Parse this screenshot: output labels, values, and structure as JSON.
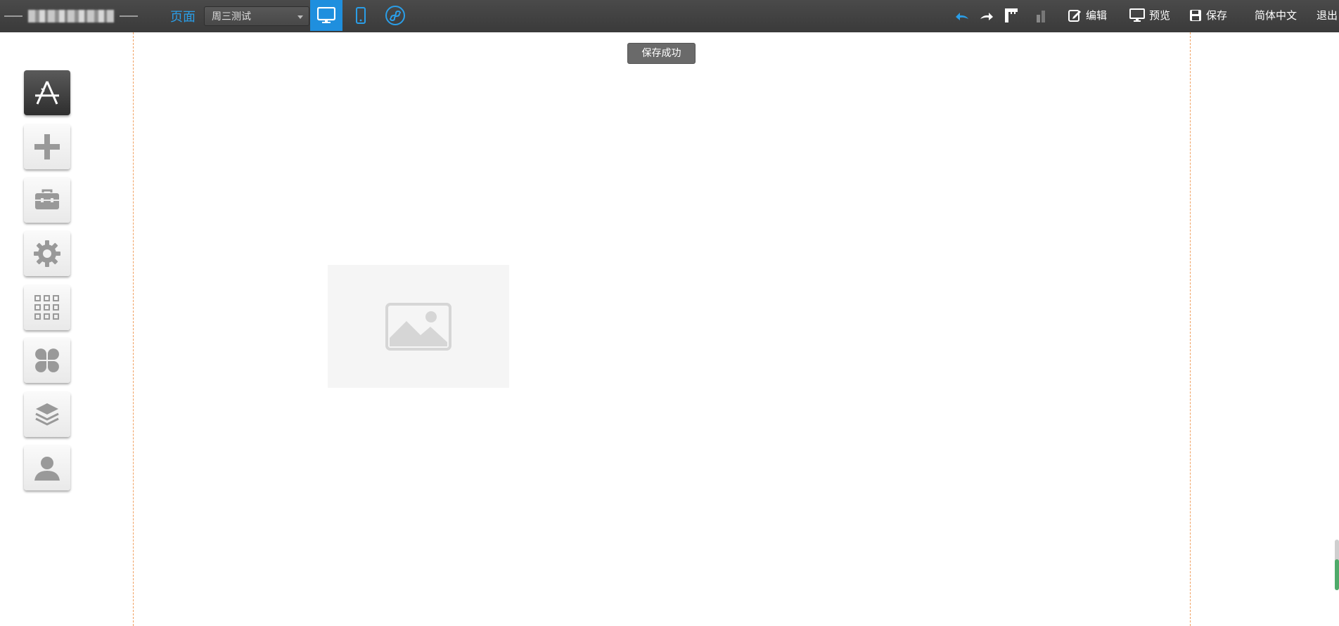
{
  "topbar": {
    "page_label": "页面",
    "page_select_value": "周三测试",
    "devices": [
      {
        "name": "desktop",
        "icon": "monitor-icon",
        "active": true
      },
      {
        "name": "mobile",
        "icon": "phone-icon",
        "active": false
      },
      {
        "name": "mini-program",
        "icon": "miniprogram-icon",
        "active": false
      }
    ],
    "edit_label": "编辑",
    "preview_label": "预览",
    "save_label": "保存",
    "language_label": "简体中文",
    "logout_label": "退出"
  },
  "toast": {
    "message": "保存成功"
  },
  "sidebar": {
    "items": [
      {
        "icon": "design-icon"
      },
      {
        "icon": "plus-icon"
      },
      {
        "icon": "toolbox-icon"
      },
      {
        "icon": "gear-icon"
      },
      {
        "icon": "grid-icon"
      },
      {
        "icon": "clover-icon"
      },
      {
        "icon": "layers-icon"
      },
      {
        "icon": "user-icon"
      }
    ]
  },
  "colors": {
    "topbar_bg": "#3f3f3f",
    "accent": "#1f8fde",
    "page_label": "#2a9ee8",
    "guide_line": "#f0a060",
    "toast_bg": "#6a6a6a"
  }
}
